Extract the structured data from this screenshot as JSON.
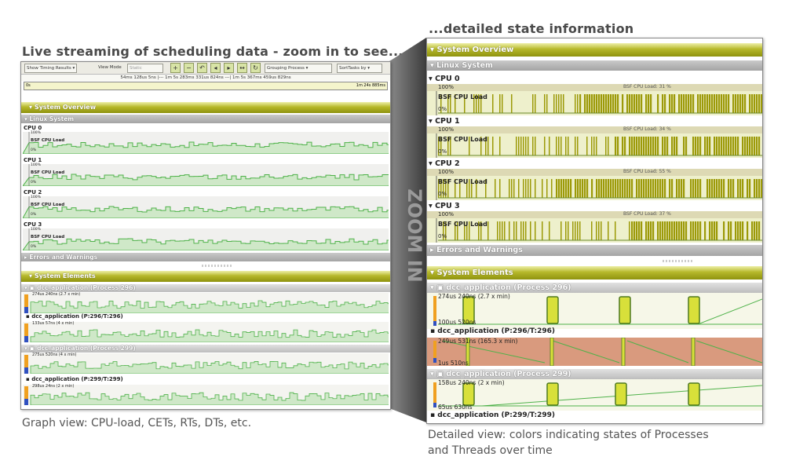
{
  "headings": {
    "left": "Live streaming of scheduling data - zoom in to see...",
    "right": "...detailed state information"
  },
  "captions": {
    "left": "Graph view: CPU-load, CETs, RTs, DTs, etc.",
    "right_line1": "Detailed view: colors indicating states of Processes",
    "right_line2": "and Threads over time"
  },
  "zoom_label": "ZOOM IN",
  "toolbar": {
    "timing_results": "Show Timing Results",
    "view_mode_label": "View Mode",
    "view_mode_value": "Static",
    "grouping": "Grouping Process",
    "sort": "SortTasks by"
  },
  "time_info": "54ms 128us 5ns |--- 1m 5s 283ms 331us 824ns ---| 1m 5s 367ms 459us 829ns",
  "timeline": {
    "start": "0s",
    "end": "1m 24s 885ms"
  },
  "left": {
    "system_overview": "System Overview",
    "linux_system": "Linux System",
    "cpus": [
      {
        "name": "CPU 0",
        "load_label": "BSF CPU Load",
        "top": "100%",
        "bottom": "0%"
      },
      {
        "name": "CPU 1",
        "load_label": "BSF CPU Load",
        "top": "100%",
        "bottom": "0%"
      },
      {
        "name": "CPU 2",
        "load_label": "BSF CPU Load",
        "top": "100%",
        "bottom": "0%"
      },
      {
        "name": "CPU 3",
        "load_label": "BSF CPU Load",
        "top": "100%",
        "bottom": "0%"
      }
    ],
    "errors": "Errors and Warnings",
    "system_elements": "System Elements",
    "processes": [
      {
        "title": "dcc_application (Process 296)",
        "value": "274us 240ns (2.7 x min)"
      },
      {
        "title": "dcc_application (P:296/T:296)",
        "value": "133us 57ns (4 x min)"
      },
      {
        "title": "dcc_application (Process 299)",
        "value": "275us 520ns (4 x min)"
      },
      {
        "title": "dcc_application (P:299/T:299)",
        "value": "298us 24ns (2 x min)"
      }
    ]
  },
  "right": {
    "system_overview": "System Overview",
    "linux_system": "Linux System",
    "cpus": [
      {
        "name": "CPU 0",
        "load_label": "BSF CPU Load",
        "top": "100%",
        "bottom": "0%",
        "note": "BSF CPU Load: 31 %"
      },
      {
        "name": "CPU 1",
        "load_label": "BSF CPU Load",
        "top": "100%",
        "bottom": "0%",
        "note": "BSF CPU Load: 34 %"
      },
      {
        "name": "CPU 2",
        "load_label": "BSF CPU Load",
        "top": "100%",
        "bottom": "0%",
        "note": "BSF CPU Load: 55 %"
      },
      {
        "name": "CPU 3",
        "load_label": "BSF CPU Load",
        "top": "100%",
        "bottom": "0%",
        "note": "BSF CPU Load: 37 %"
      }
    ],
    "errors": "Errors and Warnings",
    "system_elements": "System Elements",
    "proc296": {
      "title": "dcc_application (Process 296)",
      "top": "274us 240ns (2.7 x min)",
      "bottom": "100us 520ns"
    },
    "thr296": {
      "title": "dcc_application (P:296/T:296)",
      "top": "249us 531ns (165.3 x min)",
      "bottom": "1us 510ns"
    },
    "proc299": {
      "title": "dcc_application (Process 299)",
      "top": "158us 240ns (2 x min)",
      "bottom": "65us 630ns"
    },
    "thr299": {
      "title": "dcc_application (P:299/T:299)"
    }
  },
  "colors": {
    "olive": "#a4a81a",
    "graph_green": "#4fb24a",
    "graph_fill": "#cfe8c8",
    "dense_olive": "#9c9a08",
    "thread_red": "#d99a7e",
    "process_box": "#d8e03a"
  }
}
